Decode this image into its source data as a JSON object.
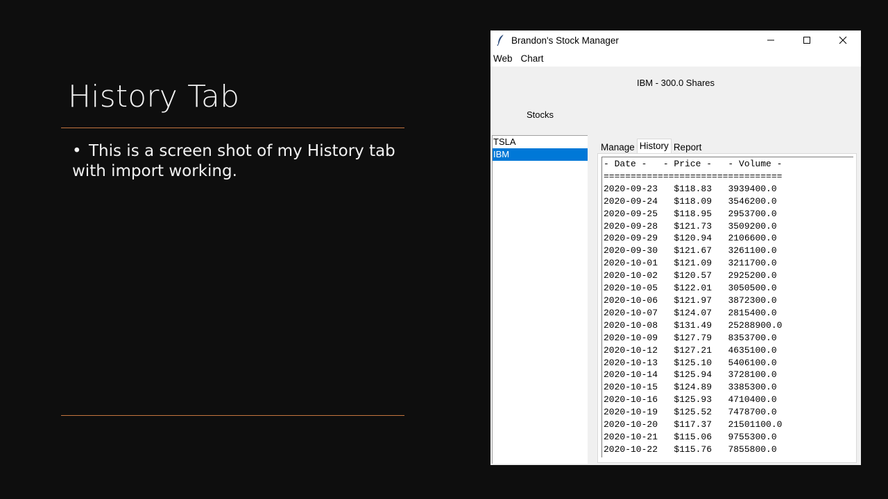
{
  "slide": {
    "title": "History Tab",
    "bullet_mark": "•",
    "bullet": "This is a screen shot of my History tab with import working."
  },
  "window": {
    "title": "Brandon's Stock Manager",
    "icon": "feather-icon",
    "controls": {
      "minimize": "minimize-icon",
      "maximize": "maximize-icon",
      "close": "close-icon"
    }
  },
  "menu": {
    "items": [
      "Web",
      "Chart"
    ]
  },
  "header_label": "IBM - 300.0 Shares",
  "stocks_label": "Stocks",
  "stock_list": {
    "items": [
      "TSLA",
      "IBM"
    ],
    "selected": "IBM"
  },
  "tabs": {
    "items": [
      "Manage",
      "History",
      "Report"
    ],
    "active": "History"
  },
  "history": {
    "header": "- Date -   - Price -   - Volume -",
    "separator": "=================================",
    "rows": [
      {
        "date": "2020-09-23",
        "price": "$118.83",
        "volume": "3939400.0"
      },
      {
        "date": "2020-09-24",
        "price": "$118.09",
        "volume": "3546200.0"
      },
      {
        "date": "2020-09-25",
        "price": "$118.95",
        "volume": "2953700.0"
      },
      {
        "date": "2020-09-28",
        "price": "$121.73",
        "volume": "3509200.0"
      },
      {
        "date": "2020-09-29",
        "price": "$120.94",
        "volume": "2106600.0"
      },
      {
        "date": "2020-09-30",
        "price": "$121.67",
        "volume": "3261100.0"
      },
      {
        "date": "2020-10-01",
        "price": "$121.09",
        "volume": "3211700.0"
      },
      {
        "date": "2020-10-02",
        "price": "$120.57",
        "volume": "2925200.0"
      },
      {
        "date": "2020-10-05",
        "price": "$122.01",
        "volume": "3050500.0"
      },
      {
        "date": "2020-10-06",
        "price": "$121.97",
        "volume": "3872300.0"
      },
      {
        "date": "2020-10-07",
        "price": "$124.07",
        "volume": "2815400.0"
      },
      {
        "date": "2020-10-08",
        "price": "$131.49",
        "volume": "25288900.0"
      },
      {
        "date": "2020-10-09",
        "price": "$127.79",
        "volume": "8353700.0"
      },
      {
        "date": "2020-10-12",
        "price": "$127.21",
        "volume": "4635100.0"
      },
      {
        "date": "2020-10-13",
        "price": "$125.10",
        "volume": "5406100.0"
      },
      {
        "date": "2020-10-14",
        "price": "$125.94",
        "volume": "3728100.0"
      },
      {
        "date": "2020-10-15",
        "price": "$124.89",
        "volume": "3385300.0"
      },
      {
        "date": "2020-10-16",
        "price": "$125.93",
        "volume": "4710400.0"
      },
      {
        "date": "2020-10-19",
        "price": "$125.52",
        "volume": "7478700.0"
      },
      {
        "date": "2020-10-20",
        "price": "$117.37",
        "volume": "21501100.0"
      },
      {
        "date": "2020-10-21",
        "price": "$115.06",
        "volume": "9755300.0"
      },
      {
        "date": "2020-10-22",
        "price": "$115.76",
        "volume": "7855800.0"
      }
    ]
  },
  "colors": {
    "slide_background": "#0e0e0e",
    "accent_rule": "#c4753f",
    "selection": "#0078d7"
  }
}
